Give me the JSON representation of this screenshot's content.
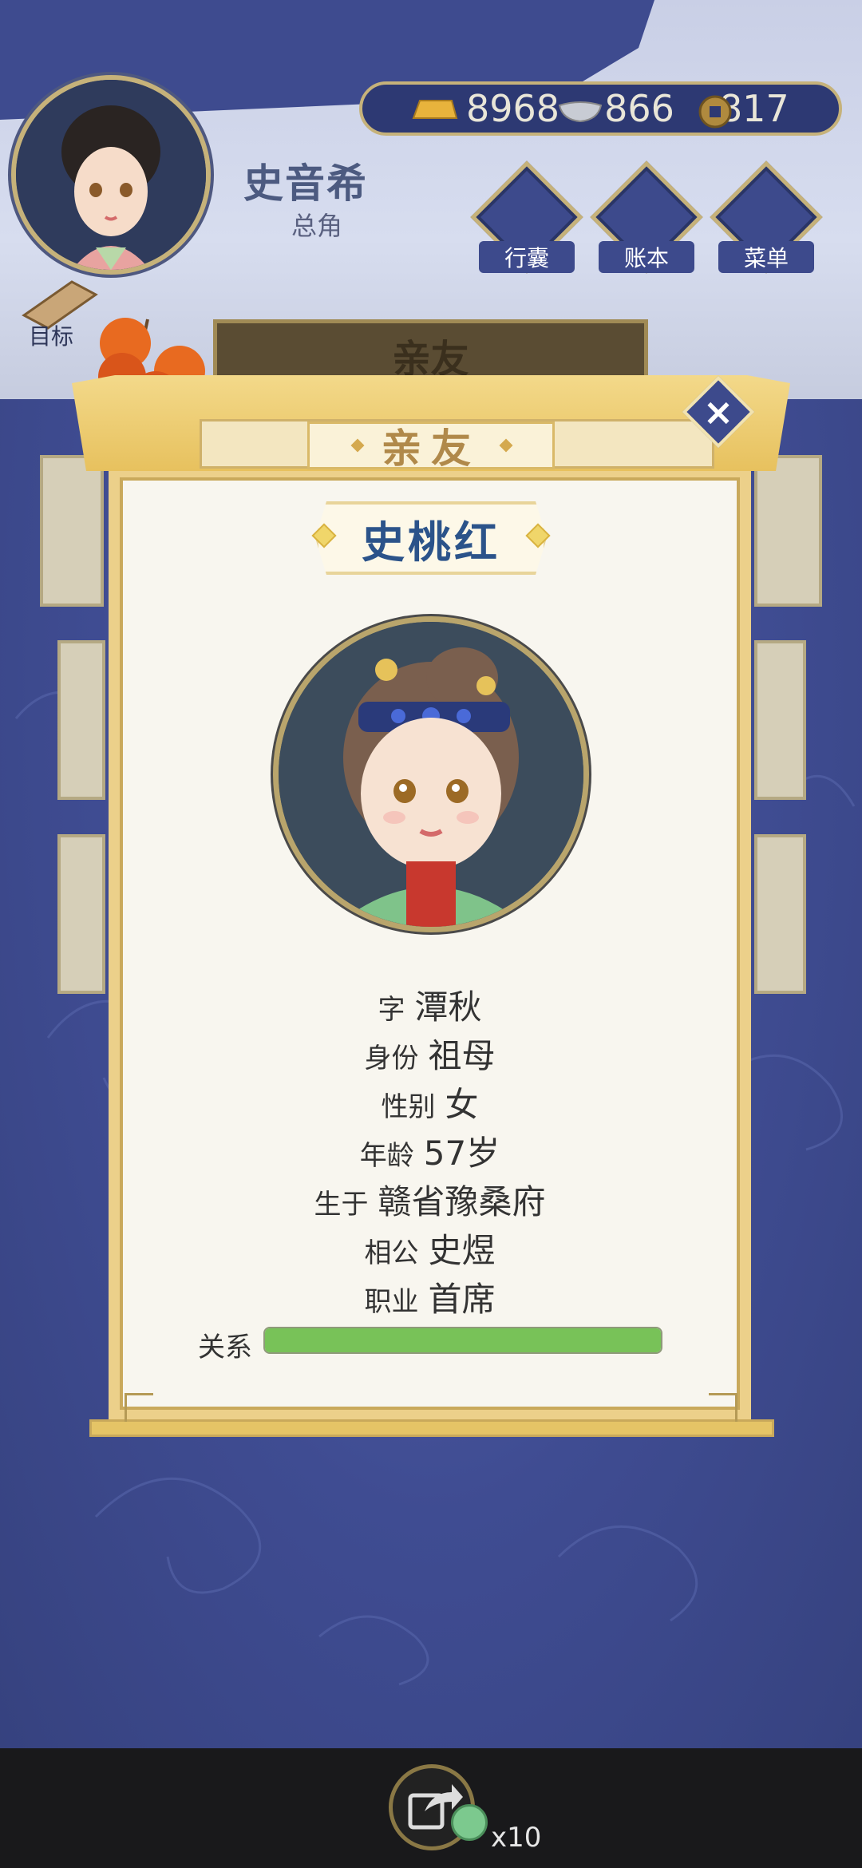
{
  "player": {
    "name": "史音希",
    "role": "总角"
  },
  "currencies": [
    {
      "icon": "gold-ingot-icon",
      "value": "8968"
    },
    {
      "icon": "silver-ingot-icon",
      "value": "866"
    },
    {
      "icon": "copper-coin-icon",
      "value": "817"
    }
  ],
  "hud_buttons": [
    {
      "icon": "bag-icon",
      "label": "行囊"
    },
    {
      "icon": "ledger-icon",
      "label": "账本"
    },
    {
      "icon": "menu-dots-icon",
      "label": "菜单"
    }
  ],
  "goal_label": "目标",
  "background_tab": "亲友",
  "dialog": {
    "title": "亲友",
    "character_name": "史桃红",
    "fields": [
      {
        "label": "字",
        "value": "潭秋"
      },
      {
        "label": "身份",
        "value": "祖母"
      },
      {
        "label": "性别",
        "value": "女"
      },
      {
        "label": "年龄",
        "value": "57岁"
      },
      {
        "label": "生于",
        "value": "赣省豫桑府"
      },
      {
        "label": "相公",
        "value": "史煜"
      },
      {
        "label": "职业",
        "value": "首席"
      }
    ],
    "relation_label": "关系",
    "relation_level": 1.0
  },
  "share": {
    "count": "x10"
  },
  "colors": {
    "accent_gold": "#e7c15e",
    "name_blue": "#2b538a",
    "relation_green": "#78c258",
    "background_navy": "#3c4a8e"
  }
}
